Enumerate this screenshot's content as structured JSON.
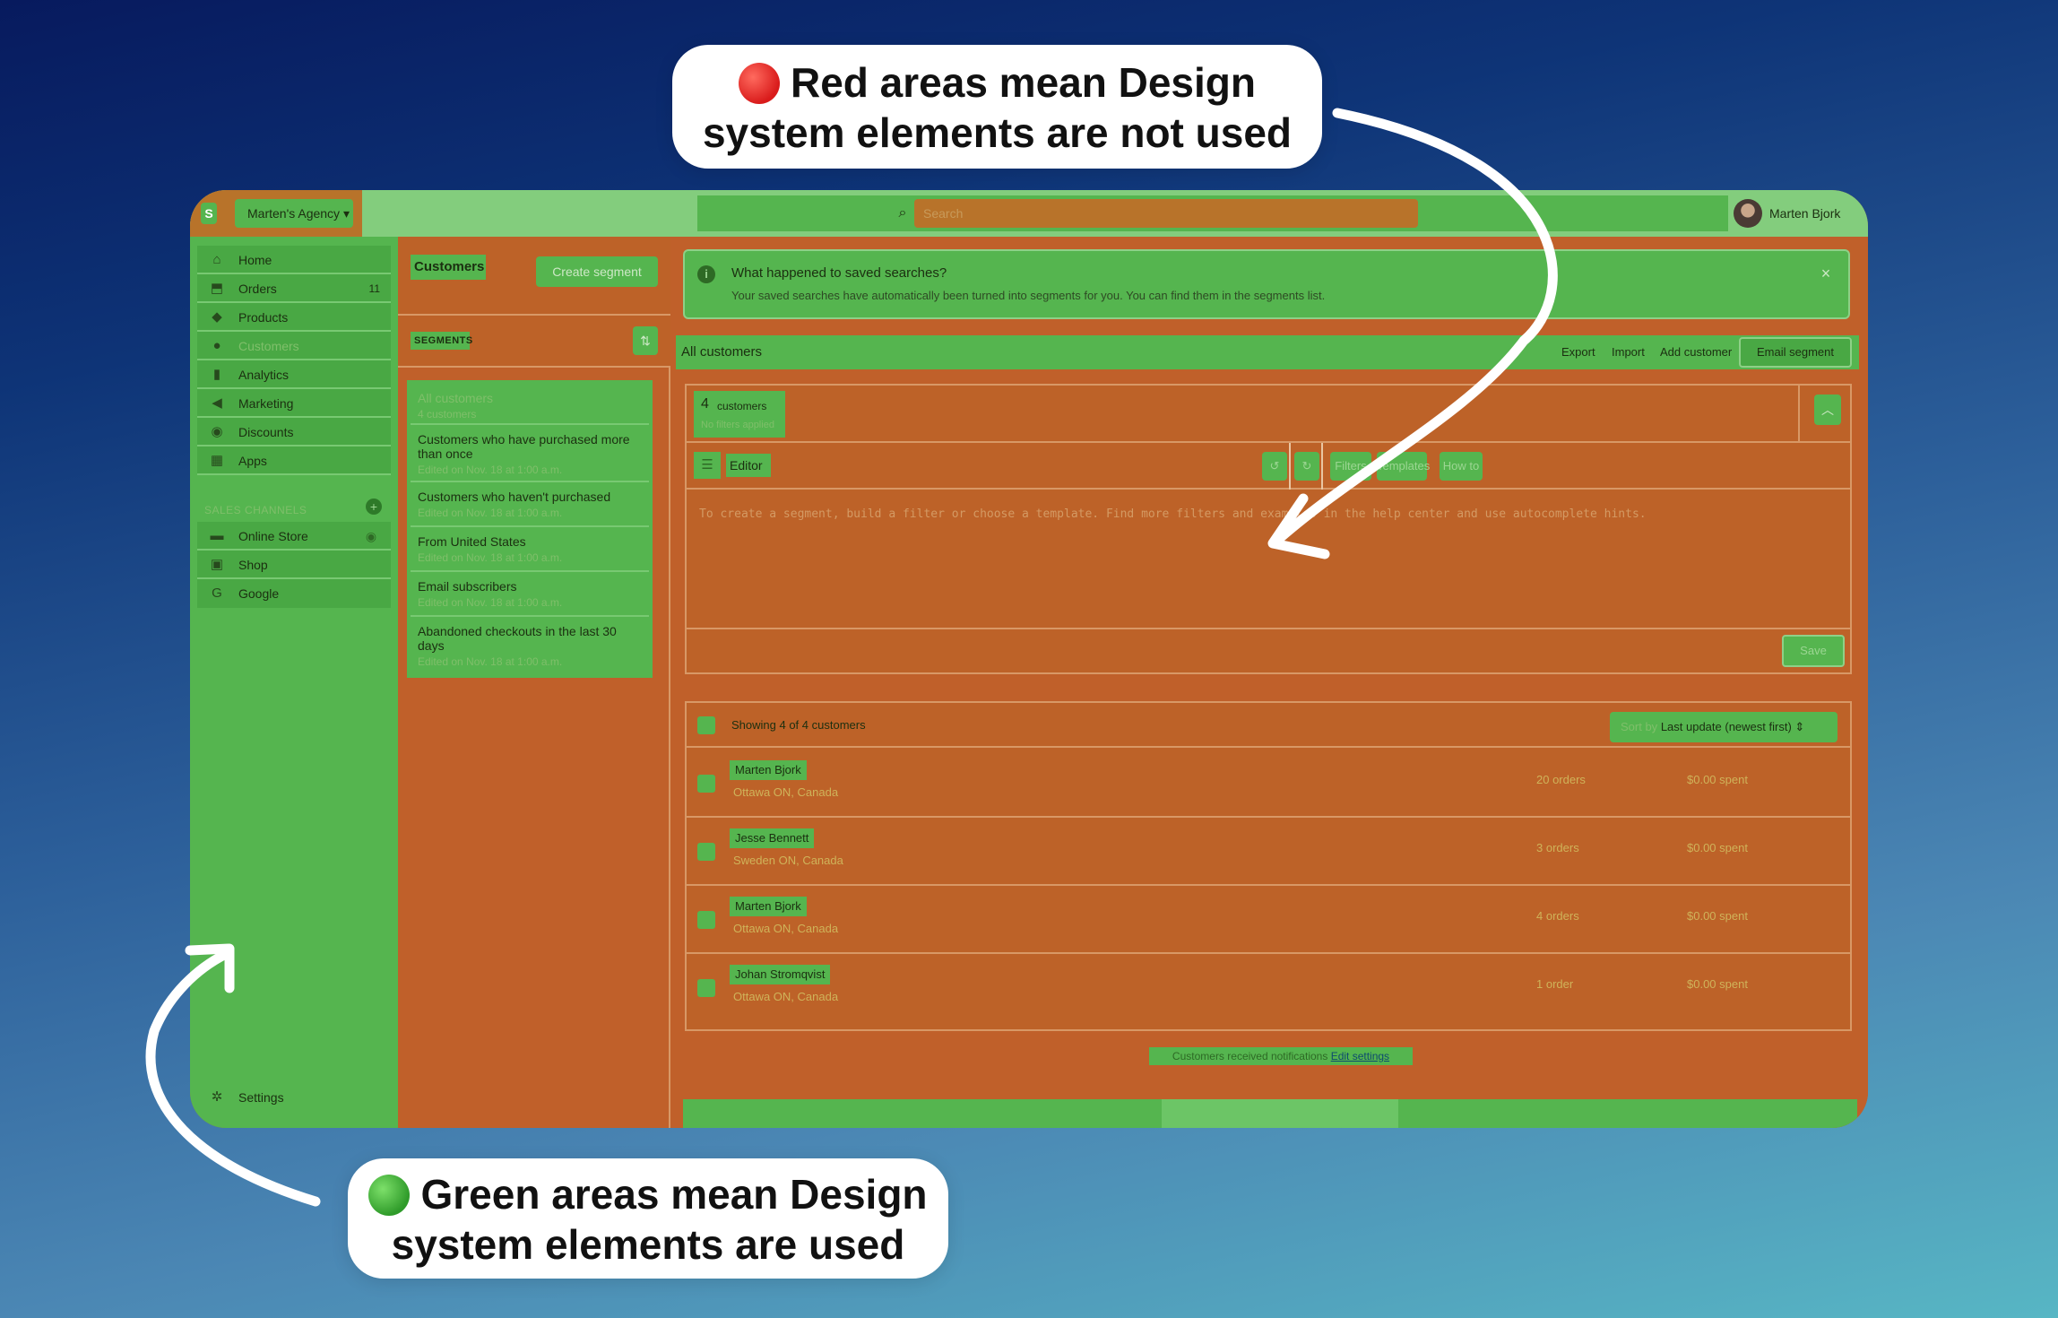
{
  "callouts": {
    "red_line1": "Red areas mean Design",
    "red_line2": "system elements are not used",
    "green_line1": "Green areas mean Design",
    "green_line2": "system elements are used"
  },
  "topbar": {
    "store_name": "Marten's Agency",
    "search_placeholder": "Search",
    "user_name": "Marten Bjork"
  },
  "sidebar": {
    "items": [
      {
        "label": "Home",
        "icon": "home-icon",
        "glyph": "⌂"
      },
      {
        "label": "Orders",
        "icon": "orders-icon",
        "glyph": "⬒",
        "badge": "11"
      },
      {
        "label": "Products",
        "icon": "tag-icon",
        "glyph": "◆"
      },
      {
        "label": "Customers",
        "icon": "person-icon",
        "glyph": "●"
      },
      {
        "label": "Analytics",
        "icon": "bar-chart-icon",
        "glyph": "▮"
      },
      {
        "label": "Marketing",
        "icon": "megaphone-icon",
        "glyph": "◀"
      },
      {
        "label": "Discounts",
        "icon": "discount-icon",
        "glyph": "◉"
      },
      {
        "label": "Apps",
        "icon": "apps-icon",
        "glyph": "▦"
      }
    ],
    "sales_channels_label": "SALES CHANNELS",
    "channels": [
      {
        "label": "Online Store",
        "icon": "store-icon",
        "glyph": "▬"
      },
      {
        "label": "Shop",
        "icon": "shop-icon",
        "glyph": "▣"
      },
      {
        "label": "Google",
        "icon": "google-icon",
        "glyph": "G"
      }
    ],
    "settings_label": "Settings"
  },
  "segments": {
    "title": "Customers",
    "create_label": "Create segment",
    "section_label": "SEGMENTS",
    "items": [
      {
        "name": "All customers",
        "detail": "4 customers"
      },
      {
        "name": "Customers who have purchased more than once",
        "detail": "Edited on Nov. 18 at 1:00 a.m."
      },
      {
        "name": "Customers who haven't purchased",
        "detail": "Edited on Nov. 18 at 1:00 a.m."
      },
      {
        "name": "From United States",
        "detail": "Edited on Nov. 18 at 1:00 a.m."
      },
      {
        "name": "Email subscribers",
        "detail": "Edited on Nov. 18 at 1:00 a.m."
      },
      {
        "name": "Abandoned checkouts in the last 30 days",
        "detail": "Edited on Nov. 18 at 1:00 a.m."
      }
    ]
  },
  "banner": {
    "title": "What happened to saved searches?",
    "body": "Your saved searches have automatically been turned into segments for you. You can find them in the segments list."
  },
  "filterbar": {
    "title": "All customers",
    "export": "Export",
    "import": "Import",
    "add": "Add customer",
    "email": "Email segment"
  },
  "editor": {
    "count": "4",
    "count_label": "customers",
    "count_sub": "No filters applied",
    "label": "Editor",
    "filters": "Filters",
    "templates": "Templates",
    "howto": "How to",
    "query": "To create a segment, build a filter or choose a template. Find more filters and examples in the help center and use autocomplete hints.",
    "save": "Save"
  },
  "list": {
    "showing": "Showing 4 of 4 customers",
    "sort_prefix": "Sort by",
    "sort_value": "Last update (newest first)",
    "rows": [
      {
        "name": "Marten Bjork",
        "location": "Ottawa ON, Canada",
        "orders": "20 orders",
        "spent": "$0.00 spent"
      },
      {
        "name": "Jesse Bennett",
        "location": "Sweden ON, Canada",
        "orders": "3 orders",
        "spent": "$0.00 spent"
      },
      {
        "name": "Marten Bjork",
        "location": "Ottawa ON, Canada",
        "orders": "4 orders",
        "spent": "$0.00 spent"
      },
      {
        "name": "Johan Stromqvist",
        "location": "Ottawa ON, Canada",
        "orders": "1 order",
        "spent": "$0.00 spent"
      }
    ]
  },
  "bottom": {
    "text": "Customers received notifications",
    "link": "Edit settings"
  },
  "colors": {
    "green_overlay": "#55b54f",
    "red_overlay": "#c0602a"
  }
}
